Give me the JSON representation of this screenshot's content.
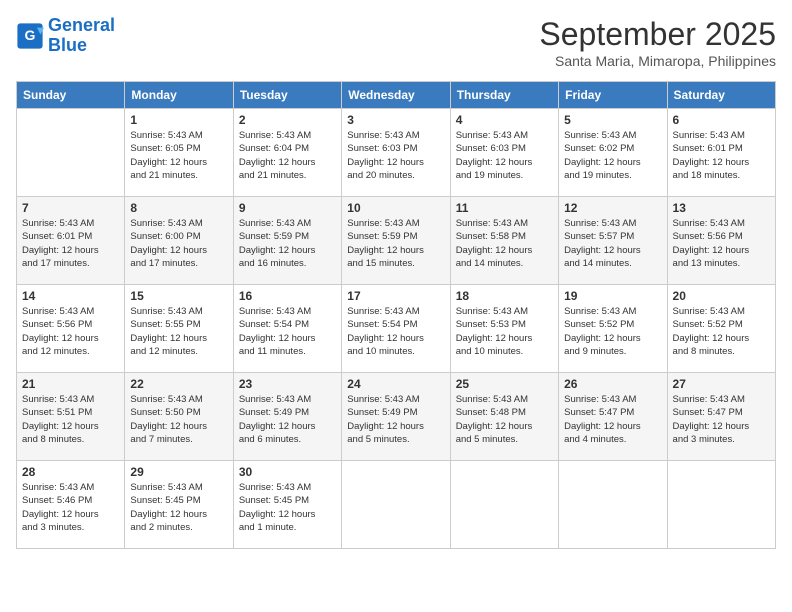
{
  "header": {
    "logo_line1": "General",
    "logo_line2": "Blue",
    "month": "September 2025",
    "location": "Santa Maria, Mimaropa, Philippines"
  },
  "weekdays": [
    "Sunday",
    "Monday",
    "Tuesday",
    "Wednesday",
    "Thursday",
    "Friday",
    "Saturday"
  ],
  "weeks": [
    [
      {
        "day": "",
        "info": ""
      },
      {
        "day": "1",
        "info": "Sunrise: 5:43 AM\nSunset: 6:05 PM\nDaylight: 12 hours\nand 21 minutes."
      },
      {
        "day": "2",
        "info": "Sunrise: 5:43 AM\nSunset: 6:04 PM\nDaylight: 12 hours\nand 21 minutes."
      },
      {
        "day": "3",
        "info": "Sunrise: 5:43 AM\nSunset: 6:03 PM\nDaylight: 12 hours\nand 20 minutes."
      },
      {
        "day": "4",
        "info": "Sunrise: 5:43 AM\nSunset: 6:03 PM\nDaylight: 12 hours\nand 19 minutes."
      },
      {
        "day": "5",
        "info": "Sunrise: 5:43 AM\nSunset: 6:02 PM\nDaylight: 12 hours\nand 19 minutes."
      },
      {
        "day": "6",
        "info": "Sunrise: 5:43 AM\nSunset: 6:01 PM\nDaylight: 12 hours\nand 18 minutes."
      }
    ],
    [
      {
        "day": "7",
        "info": "Sunrise: 5:43 AM\nSunset: 6:01 PM\nDaylight: 12 hours\nand 17 minutes."
      },
      {
        "day": "8",
        "info": "Sunrise: 5:43 AM\nSunset: 6:00 PM\nDaylight: 12 hours\nand 17 minutes."
      },
      {
        "day": "9",
        "info": "Sunrise: 5:43 AM\nSunset: 5:59 PM\nDaylight: 12 hours\nand 16 minutes."
      },
      {
        "day": "10",
        "info": "Sunrise: 5:43 AM\nSunset: 5:59 PM\nDaylight: 12 hours\nand 15 minutes."
      },
      {
        "day": "11",
        "info": "Sunrise: 5:43 AM\nSunset: 5:58 PM\nDaylight: 12 hours\nand 14 minutes."
      },
      {
        "day": "12",
        "info": "Sunrise: 5:43 AM\nSunset: 5:57 PM\nDaylight: 12 hours\nand 14 minutes."
      },
      {
        "day": "13",
        "info": "Sunrise: 5:43 AM\nSunset: 5:56 PM\nDaylight: 12 hours\nand 13 minutes."
      }
    ],
    [
      {
        "day": "14",
        "info": "Sunrise: 5:43 AM\nSunset: 5:56 PM\nDaylight: 12 hours\nand 12 minutes."
      },
      {
        "day": "15",
        "info": "Sunrise: 5:43 AM\nSunset: 5:55 PM\nDaylight: 12 hours\nand 12 minutes."
      },
      {
        "day": "16",
        "info": "Sunrise: 5:43 AM\nSunset: 5:54 PM\nDaylight: 12 hours\nand 11 minutes."
      },
      {
        "day": "17",
        "info": "Sunrise: 5:43 AM\nSunset: 5:54 PM\nDaylight: 12 hours\nand 10 minutes."
      },
      {
        "day": "18",
        "info": "Sunrise: 5:43 AM\nSunset: 5:53 PM\nDaylight: 12 hours\nand 10 minutes."
      },
      {
        "day": "19",
        "info": "Sunrise: 5:43 AM\nSunset: 5:52 PM\nDaylight: 12 hours\nand 9 minutes."
      },
      {
        "day": "20",
        "info": "Sunrise: 5:43 AM\nSunset: 5:52 PM\nDaylight: 12 hours\nand 8 minutes."
      }
    ],
    [
      {
        "day": "21",
        "info": "Sunrise: 5:43 AM\nSunset: 5:51 PM\nDaylight: 12 hours\nand 8 minutes."
      },
      {
        "day": "22",
        "info": "Sunrise: 5:43 AM\nSunset: 5:50 PM\nDaylight: 12 hours\nand 7 minutes."
      },
      {
        "day": "23",
        "info": "Sunrise: 5:43 AM\nSunset: 5:49 PM\nDaylight: 12 hours\nand 6 minutes."
      },
      {
        "day": "24",
        "info": "Sunrise: 5:43 AM\nSunset: 5:49 PM\nDaylight: 12 hours\nand 5 minutes."
      },
      {
        "day": "25",
        "info": "Sunrise: 5:43 AM\nSunset: 5:48 PM\nDaylight: 12 hours\nand 5 minutes."
      },
      {
        "day": "26",
        "info": "Sunrise: 5:43 AM\nSunset: 5:47 PM\nDaylight: 12 hours\nand 4 minutes."
      },
      {
        "day": "27",
        "info": "Sunrise: 5:43 AM\nSunset: 5:47 PM\nDaylight: 12 hours\nand 3 minutes."
      }
    ],
    [
      {
        "day": "28",
        "info": "Sunrise: 5:43 AM\nSunset: 5:46 PM\nDaylight: 12 hours\nand 3 minutes."
      },
      {
        "day": "29",
        "info": "Sunrise: 5:43 AM\nSunset: 5:45 PM\nDaylight: 12 hours\nand 2 minutes."
      },
      {
        "day": "30",
        "info": "Sunrise: 5:43 AM\nSunset: 5:45 PM\nDaylight: 12 hours\nand 1 minute."
      },
      {
        "day": "",
        "info": ""
      },
      {
        "day": "",
        "info": ""
      },
      {
        "day": "",
        "info": ""
      },
      {
        "day": "",
        "info": ""
      }
    ]
  ]
}
